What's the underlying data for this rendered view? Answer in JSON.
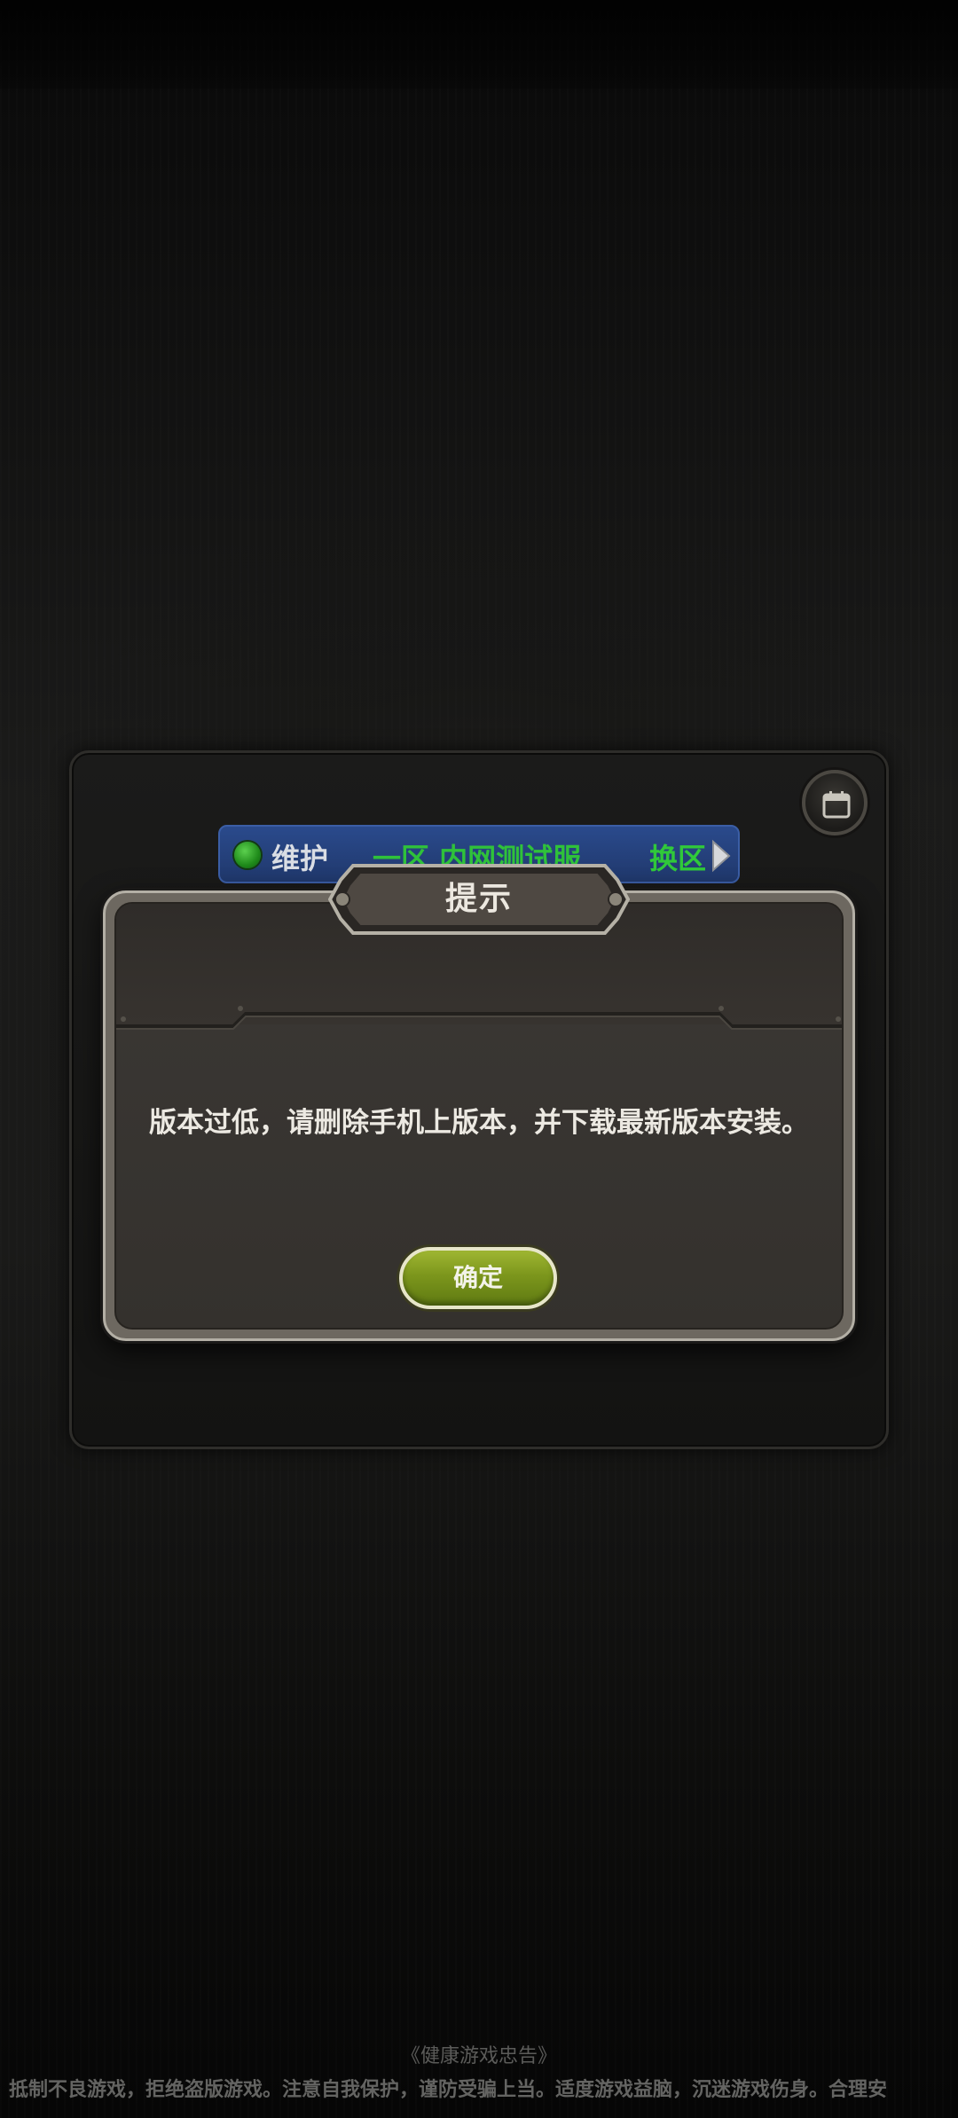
{
  "server": {
    "status": "维护",
    "name": "一区 内网测试服",
    "switch_label": "换区"
  },
  "dialog": {
    "title": "提示",
    "message": "版本过低，请删除手机上版本，并下载最新版本安装。",
    "confirm_label": "确定"
  },
  "footer": {
    "title": "《健康游戏忠告》",
    "text": "抵制不良游戏，拒绝盗版游戏。注意自我保护，谨防受骗上当。适度游戏益脑，沉迷游戏伤身。合理安"
  },
  "colors": {
    "status_dot": "#2fa02a",
    "server_name": "#2fc23a",
    "server_bar": "#26417a",
    "confirm_button": "#7c961c"
  },
  "icons": {
    "calendar": "calendar-icon",
    "status": "status-dot-icon",
    "switch": "chevron-right-icon"
  }
}
